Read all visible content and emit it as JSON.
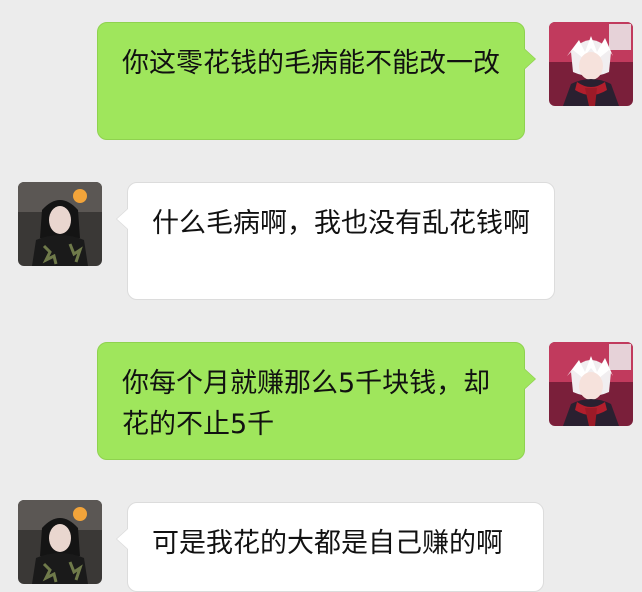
{
  "chat": {
    "messages": [
      {
        "sender": "me",
        "text": "你这零花钱的毛病能不能改一改"
      },
      {
        "sender": "other",
        "text": "什么毛病啊，我也没有乱花钱啊"
      },
      {
        "sender": "me",
        "text": "你每个月就赚那么5千块钱，却花的不止5千"
      },
      {
        "sender": "other",
        "text": "可是我花的大都是自己赚的啊"
      }
    ]
  },
  "colors": {
    "background": "#ececec",
    "outgoing_bubble": "#9fe65c",
    "incoming_bubble": "#ffffff"
  }
}
